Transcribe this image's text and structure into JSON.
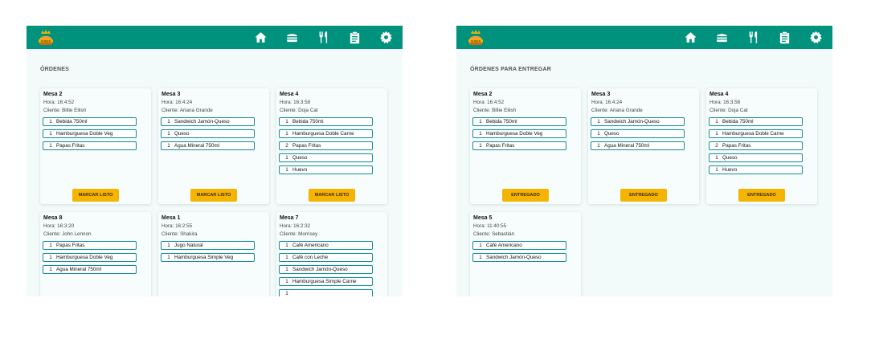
{
  "colors": {
    "accent": "#00927d",
    "panel_bg": "#f2fbf9",
    "item_border": "#138a9a",
    "button": "#f5b400"
  },
  "nav_icons": [
    "home-icon",
    "burger-icon",
    "utensils-icon",
    "clipboard-icon",
    "gear-icon"
  ],
  "logo_text": "QUEEN",
  "left": {
    "title": "ÓRDENES",
    "button_label": "MARCAR LISTO",
    "orders": [
      {
        "mesa": "Mesa 2",
        "hora": "Hora: 16:4:52",
        "cliente": "Cliente: Billie Eilish",
        "items": [
          {
            "qty": "1",
            "name": "Bebida 750ml"
          },
          {
            "qty": "1",
            "name": "Hamburguesa Doble Veg"
          },
          {
            "qty": "1",
            "name": "Papas Fritas"
          }
        ]
      },
      {
        "mesa": "Mesa 3",
        "hora": "Hora: 16:4:24",
        "cliente": "Cliente: Ariana Grande",
        "items": [
          {
            "qty": "1",
            "name": "Sandwich Jamón-Queso"
          },
          {
            "qty": "1",
            "name": "Queso"
          },
          {
            "qty": "1",
            "name": "Agua Mineral 750ml"
          }
        ]
      },
      {
        "mesa": "Mesa 4",
        "hora": "Hora: 16:3:58",
        "cliente": "Cliente: Doja Cat",
        "items": [
          {
            "qty": "1",
            "name": "Bebida 750ml"
          },
          {
            "qty": "1",
            "name": "Hamburguesa Doble Carne"
          },
          {
            "qty": "2",
            "name": "Papas Fritas"
          },
          {
            "qty": "1",
            "name": "Queso"
          },
          {
            "qty": "1",
            "name": "Huevo"
          }
        ]
      },
      {
        "mesa": "Mesa 8",
        "hora": "Hora: 16:3:20",
        "cliente": "Cliente: John Lennon",
        "items": [
          {
            "qty": "1",
            "name": "Papas Fritas"
          },
          {
            "qty": "1",
            "name": "Hamburguesa Doble Veg"
          },
          {
            "qty": "1",
            "name": "Agua Mineral 750ml"
          }
        ]
      },
      {
        "mesa": "Mesa 1",
        "hora": "Hora: 16:2:55",
        "cliente": "Cliente: Shakira",
        "items": [
          {
            "qty": "1",
            "name": "Jugo Natural"
          },
          {
            "qty": "1",
            "name": "Hamburguesa Simple Veg"
          }
        ]
      },
      {
        "mesa": "Mesa 7",
        "hora": "Hora: 16:2:32",
        "cliente": "Cliente: Morrisey",
        "items": [
          {
            "qty": "1",
            "name": "Café Americano"
          },
          {
            "qty": "1",
            "name": "Café con Leche"
          },
          {
            "qty": "1",
            "name": "Sandwich Jamón-Queso"
          },
          {
            "qty": "1",
            "name": "Hamburguesa Simple Carne"
          },
          {
            "qty": "1",
            "name": ""
          }
        ]
      }
    ]
  },
  "right": {
    "title": "ÓRDENES PARA ENTREGAR",
    "button_label": "ENTREGADO",
    "orders": [
      {
        "mesa": "Mesa 2",
        "hora": "Hora: 16:4:52",
        "cliente": "Cliente: Billie Eilish",
        "items": [
          {
            "qty": "1",
            "name": "Bebida 750ml"
          },
          {
            "qty": "1",
            "name": "Hamburguesa Doble Veg"
          },
          {
            "qty": "1",
            "name": "Papas Fritas"
          }
        ]
      },
      {
        "mesa": "Mesa 3",
        "hora": "Hora: 16:4:24",
        "cliente": "Cliente: Ariana Grande",
        "items": [
          {
            "qty": "1",
            "name": "Sandwich Jamón-Queso"
          },
          {
            "qty": "1",
            "name": "Queso"
          },
          {
            "qty": "1",
            "name": "Agua Mineral 750ml"
          }
        ]
      },
      {
        "mesa": "Mesa 4",
        "hora": "Hora: 16:3:58",
        "cliente": "Cliente: Doja Cat",
        "items": [
          {
            "qty": "1",
            "name": "Bebida 750ml"
          },
          {
            "qty": "1",
            "name": "Hamburguesa Doble Carne"
          },
          {
            "qty": "2",
            "name": "Papas Fritas"
          },
          {
            "qty": "1",
            "name": "Queso"
          },
          {
            "qty": "1",
            "name": "Huevo"
          }
        ]
      },
      {
        "mesa": "Mesa 5",
        "hora": "Hora: 11:40:55",
        "cliente": "Cliente: Sebastián",
        "items": [
          {
            "qty": "1",
            "name": "Café Americano"
          },
          {
            "qty": "1",
            "name": "Sandwich Jamón-Queso"
          }
        ]
      }
    ]
  }
}
